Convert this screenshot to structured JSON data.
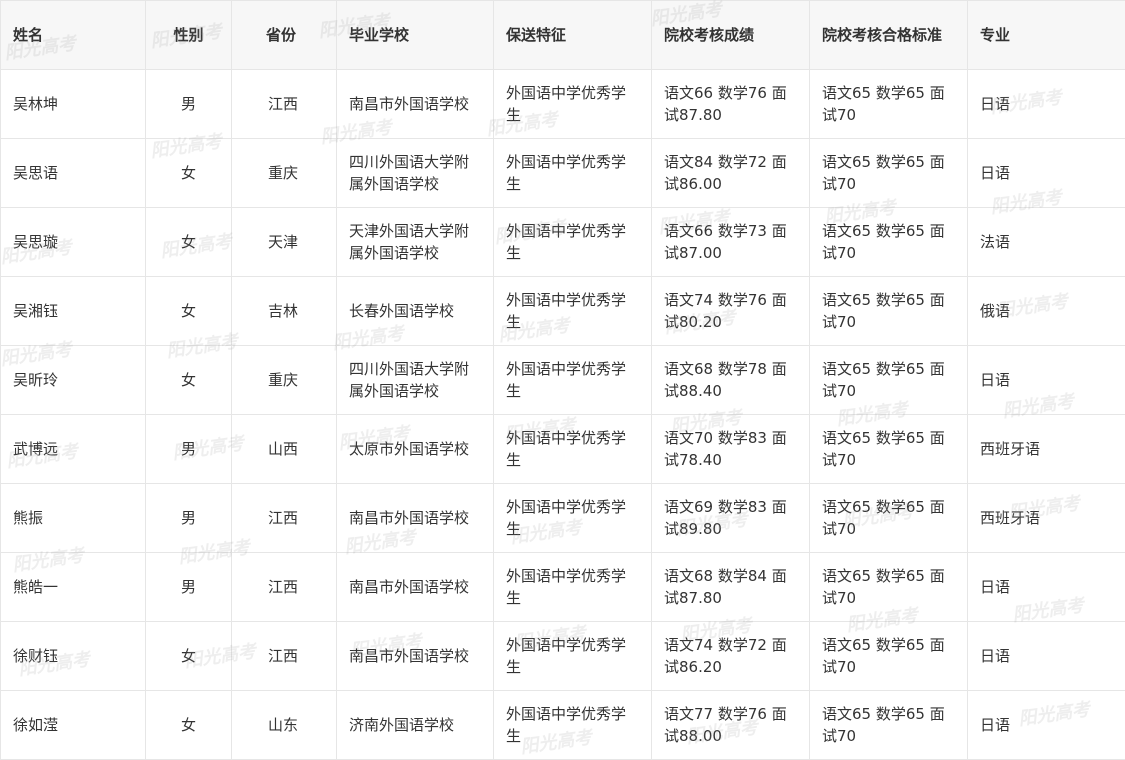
{
  "watermark": "阳光高考",
  "table": {
    "headers": [
      "姓名",
      "性别",
      "省份",
      "毕业学校",
      "保送特征",
      "院校考核成绩",
      "院校考核合格标准",
      "专业"
    ],
    "rows": [
      [
        "吴林坤",
        "男",
        "江西",
        "南昌市外国语学校",
        "外国语中学优秀学生",
        "语文66 数学76 面试87.80",
        "语文65 数学65 面试70",
        "日语"
      ],
      [
        "吴思语",
        "女",
        "重庆",
        "四川外国语大学附属外国语学校",
        "外国语中学优秀学生",
        "语文84 数学72 面试86.00",
        "语文65 数学65 面试70",
        "日语"
      ],
      [
        "吴思璇",
        "女",
        "天津",
        "天津外国语大学附属外国语学校",
        "外国语中学优秀学生",
        "语文66 数学73 面试87.00",
        "语文65 数学65 面试70",
        "法语"
      ],
      [
        "吴湘钰",
        "女",
        "吉林",
        "长春外国语学校",
        "外国语中学优秀学生",
        "语文74 数学76 面试80.20",
        "语文65 数学65 面试70",
        "俄语"
      ],
      [
        "吴昕玲",
        "女",
        "重庆",
        "四川外国语大学附属外国语学校",
        "外国语中学优秀学生",
        "语文68 数学78 面试88.40",
        "语文65 数学65 面试70",
        "日语"
      ],
      [
        "武博远",
        "男",
        "山西",
        "太原市外国语学校",
        "外国语中学优秀学生",
        "语文70 数学83 面试78.40",
        "语文65 数学65 面试70",
        "西班牙语"
      ],
      [
        "熊振",
        "男",
        "江西",
        "南昌市外国语学校",
        "外国语中学优秀学生",
        "语文69 数学83 面试89.80",
        "语文65 数学65 面试70",
        "西班牙语"
      ],
      [
        "熊皓一",
        "男",
        "江西",
        "南昌市外国语学校",
        "外国语中学优秀学生",
        "语文68 数学84 面试87.80",
        "语文65 数学65 面试70",
        "日语"
      ],
      [
        "徐财钰",
        "女",
        "江西",
        "南昌市外国语学校",
        "外国语中学优秀学生",
        "语文74 数学72 面试86.20",
        "语文65 数学65 面试70",
        "日语"
      ],
      [
        "徐如滢",
        "女",
        "山东",
        "济南外国语学校",
        "外国语中学优秀学生",
        "语文77 数学76 面试88.00",
        "语文65 数学65 面试70",
        "日语"
      ]
    ]
  }
}
